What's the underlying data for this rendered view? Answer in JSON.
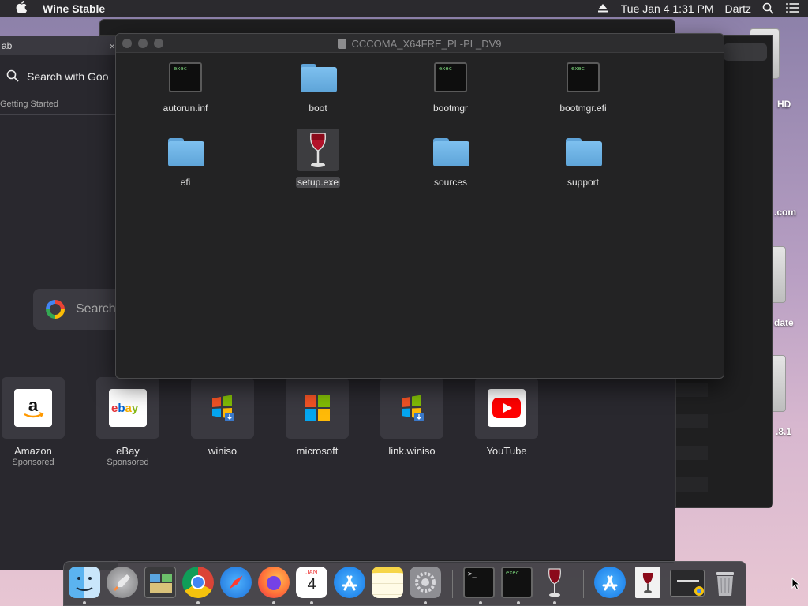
{
  "menubar": {
    "app_name": "Wine Stable",
    "datetime": "Tue Jan 4  1:31 PM",
    "user": "Dartz",
    "icons": [
      "apple-icon",
      "eject-icon",
      "search-icon",
      "menu-list-icon"
    ]
  },
  "desktop": {
    "labels": [
      "HD",
      ".com",
      "date",
      ".8.1"
    ]
  },
  "browser": {
    "tab_title": "ab",
    "tab_close": "×",
    "omnibox_placeholder": "Search with Goo",
    "bookmark": "Getting Started",
    "google_search_placeholder": "Search",
    "shortcuts": [
      {
        "name": "Amazon",
        "sub": "Sponsored",
        "icon": "amazon-icon"
      },
      {
        "name": "eBay",
        "sub": "Sponsored",
        "icon": "ebay-icon"
      },
      {
        "name": "winiso",
        "sub": "",
        "icon": "windows-installer-icon"
      },
      {
        "name": "microsoft",
        "sub": "",
        "icon": "microsoft-icon"
      },
      {
        "name": "link.winiso",
        "sub": "",
        "icon": "windows-installer-icon"
      },
      {
        "name": "YouTube",
        "sub": "",
        "icon": "youtube-icon"
      }
    ]
  },
  "finder": {
    "title": "CCCOMA_X64FRE_PL-PL_DV9",
    "exec_text": "exec",
    "items": [
      {
        "name": "autorun.inf",
        "type": "exec"
      },
      {
        "name": "boot",
        "type": "folder"
      },
      {
        "name": "bootmgr",
        "type": "exec"
      },
      {
        "name": "bootmgr.efi",
        "type": "exec"
      },
      {
        "name": "efi",
        "type": "folder"
      },
      {
        "name": "setup.exe",
        "type": "wine",
        "selected": true
      },
      {
        "name": "sources",
        "type": "folder"
      },
      {
        "name": "support",
        "type": "folder"
      }
    ]
  },
  "dock": {
    "apps": [
      "finder-icon",
      "launchpad-icon",
      "photo-browser-icon",
      "chrome-icon",
      "safari-icon",
      "firefox-icon",
      "calendar-icon",
      "app-store-icon",
      "notes-icon",
      "system-preferences-icon",
      "terminal-icon",
      "exec-icon",
      "wine-icon",
      "app-store-icon",
      "wine-document-icon",
      "browser-window-icon",
      "trash-icon"
    ],
    "calendar_month": "JAN",
    "calendar_day": "4",
    "exec_text": "exec",
    "terminal_prompt": ">_"
  },
  "colors": {
    "menubar_bg": "#2b2a2e",
    "window_bg": "#232324",
    "folder_blue": "#6fb3e6",
    "exec_text": "#7bd47b",
    "youtube_red": "#ff0000"
  }
}
